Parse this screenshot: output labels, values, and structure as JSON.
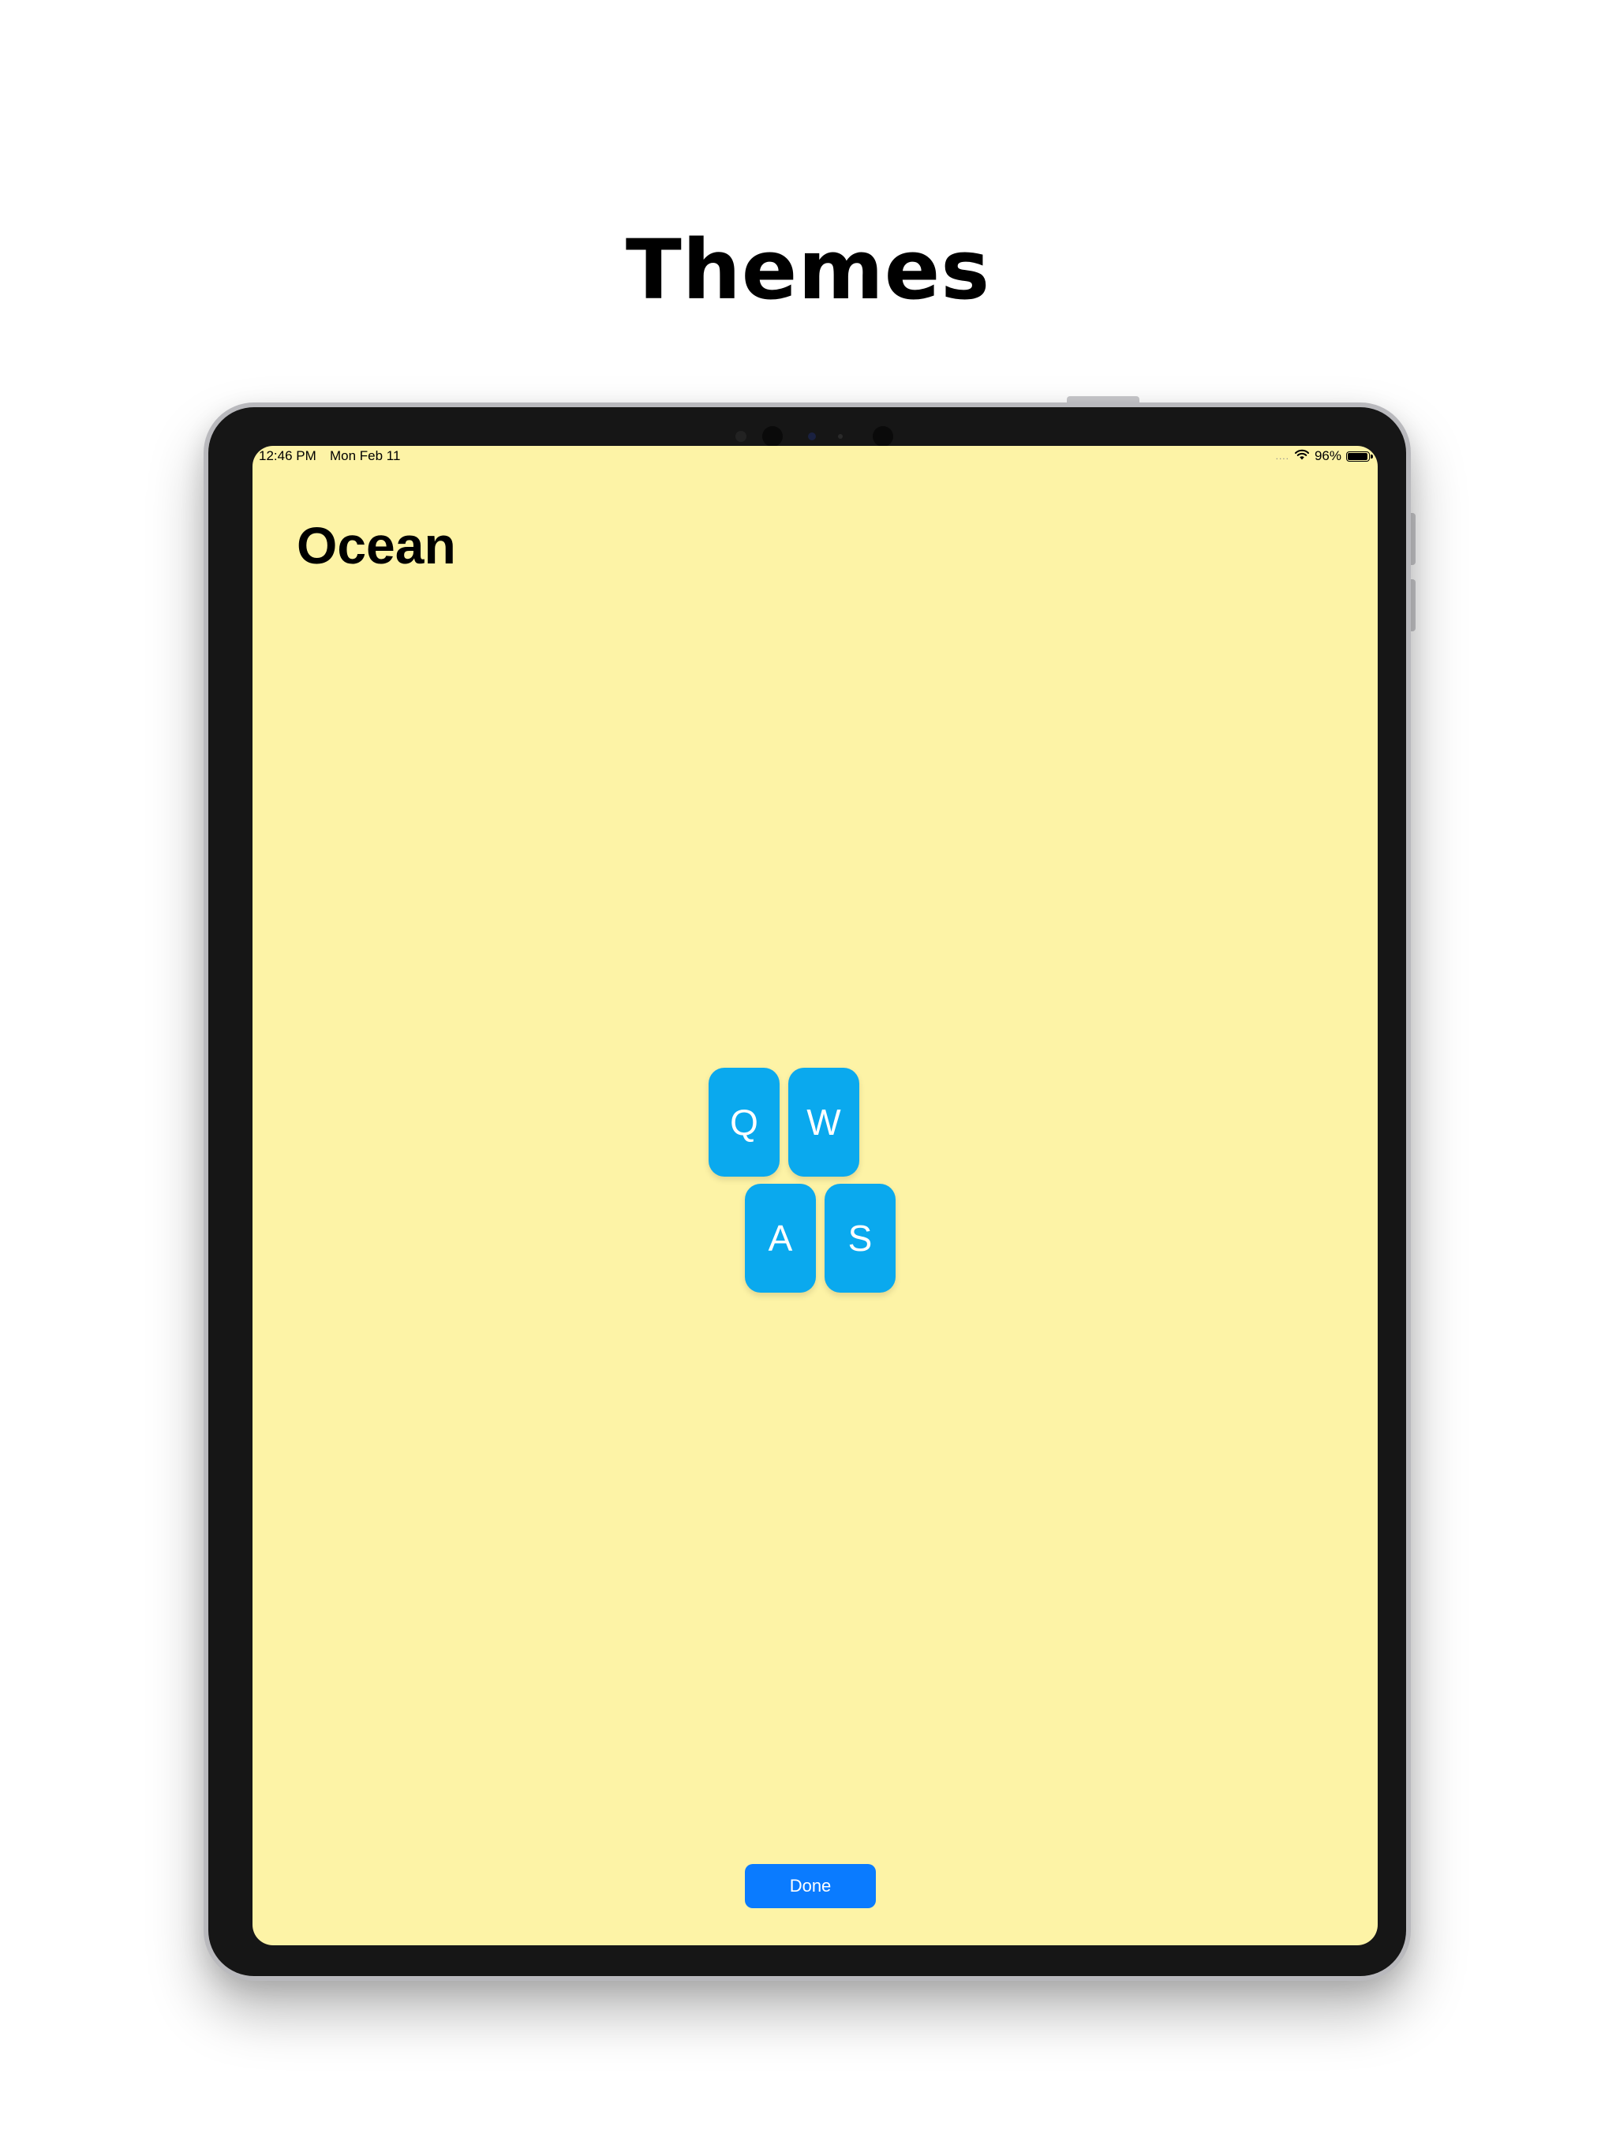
{
  "headline": "Themes",
  "status_bar": {
    "time": "12:46 PM",
    "date": "Mon Feb 11",
    "signal": "....",
    "wifi_icon": "wifi-icon",
    "battery_text": "96%",
    "battery_level": 0.96
  },
  "screen": {
    "background_color": "#fdf3a6",
    "title": "Ocean",
    "keys": [
      {
        "label": "Q"
      },
      {
        "label": "W"
      },
      {
        "label": "A"
      },
      {
        "label": "S"
      }
    ],
    "key_color": "#0aa9ee",
    "done_button": {
      "label": "Done",
      "color": "#0a7bff"
    }
  }
}
